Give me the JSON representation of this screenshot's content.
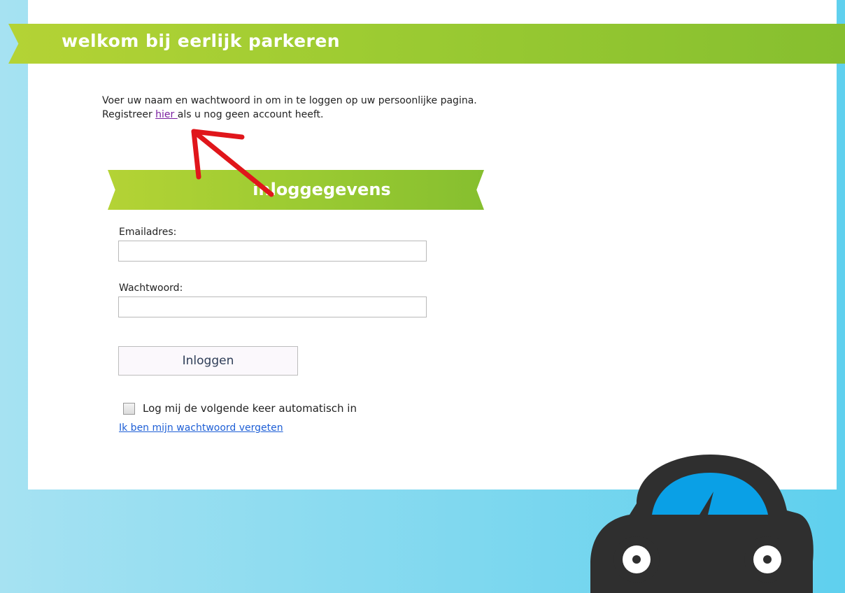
{
  "header": {
    "title": "welkom bij eerlijk parkeren"
  },
  "intro": {
    "line1": "Voer uw naam en wachtwoord in om in te loggen op uw persoonlijke pagina.",
    "line2_prefix": "Registreer ",
    "register_link": "hier ",
    "line2_suffix": "als u nog geen account heeft."
  },
  "login": {
    "section_title": "inloggegevens",
    "email_label": "Emailadres:",
    "email_value": "",
    "password_label": "Wachtwoord:",
    "password_value": "",
    "submit_label": "Inloggen",
    "remember_label": "Log mij de volgende keer automatisch in",
    "remember_checked": false,
    "forgot_link": "Ik ben mijn wachtwoord vergeten"
  },
  "colors": {
    "banner": "#9ccb32",
    "background": "#7fd8ef",
    "link_visited": "#7a1fa0",
    "link": "#1e5fd6",
    "annotation_arrow": "#e0161b",
    "car_body": "#2f2f2f",
    "car_window": "#0aa0e6"
  },
  "icons": {
    "arrow": "red-arrow-annotation",
    "car": "car-logo-icon"
  }
}
